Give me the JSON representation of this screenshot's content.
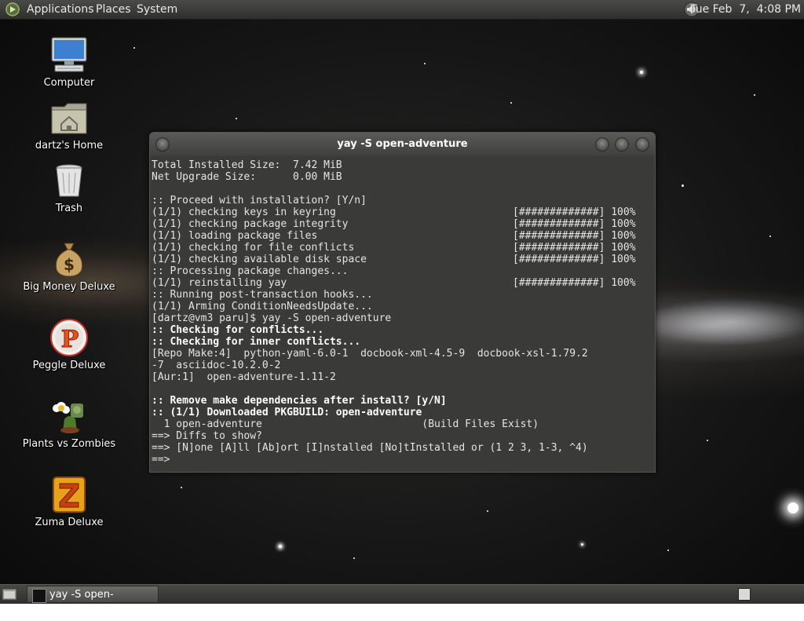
{
  "top_panel": {
    "menus": [
      "Applications",
      "Places",
      "System"
    ],
    "clock": "Tue Feb  7,  4:08 PM"
  },
  "desktop_icons": [
    {
      "label": "Computer",
      "icon": "computer-icon"
    },
    {
      "label": "dartz's Home",
      "icon": "home-folder-icon"
    },
    {
      "label": "Trash",
      "icon": "trash-icon"
    },
    {
      "label": "Big Money Deluxe",
      "icon": "money-bag-icon"
    },
    {
      "label": "Peggle Deluxe",
      "icon": "peggle-icon"
    },
    {
      "label": "Plants vs Zombies",
      "icon": "plants-vs-zombies-icon"
    },
    {
      "label": "Zuma Deluxe",
      "icon": "zuma-icon"
    }
  ],
  "terminal": {
    "title": "yay -S open-adventure",
    "lines": [
      {
        "text": "Total Installed Size:  7.42 MiB"
      },
      {
        "text": "Net Upgrade Size:      0.00 MiB"
      },
      {
        "text": ""
      },
      {
        "text": ":: Proceed with installation? [Y/n]"
      },
      {
        "text": "(1/1) checking keys in keyring",
        "progress": "[#############] 100%"
      },
      {
        "text": "(1/1) checking package integrity",
        "progress": "[#############] 100%"
      },
      {
        "text": "(1/1) loading package files",
        "progress": "[#############] 100%"
      },
      {
        "text": "(1/1) checking for file conflicts",
        "progress": "[#############] 100%"
      },
      {
        "text": "(1/1) checking available disk space",
        "progress": "[#############] 100%"
      },
      {
        "text": ":: Processing package changes..."
      },
      {
        "text": "(1/1) reinstalling yay",
        "progress": "[#############] 100%"
      },
      {
        "text": ":: Running post-transaction hooks..."
      },
      {
        "text": "(1/1) Arming ConditionNeedsUpdate..."
      },
      {
        "text": "[dartz@vm3 paru]$ yay -S open-adventure"
      },
      {
        "text": ":: Checking for conflicts...",
        "bold": true
      },
      {
        "text": ":: Checking for inner conflicts...",
        "bold": true
      },
      {
        "text": "[Repo Make:4]  python-yaml-6.0-1  docbook-xml-4.5-9  docbook-xsl-1.79.2"
      },
      {
        "text": "-7  asciidoc-10.2.0-2"
      },
      {
        "text": "[Aur:1]  open-adventure-1.11-2"
      },
      {
        "text": ""
      },
      {
        "text": ":: Remove make dependencies after install? [y/N]",
        "bold": true
      },
      {
        "text": ":: (1/1) Downloaded PKGBUILD: open-adventure",
        "bold": true
      },
      {
        "text": "  1 open-adventure                          (Build Files Exist)"
      },
      {
        "text": "==> Diffs to show?"
      },
      {
        "text": "==> [N]one [A]ll [Ab]ort [I]nstalled [No]tInstalled or (1 2 3, 1-3, ^4)"
      },
      {
        "text": "==>"
      }
    ]
  },
  "bottom_panel": {
    "task_label": "yay -S open-adventure"
  }
}
